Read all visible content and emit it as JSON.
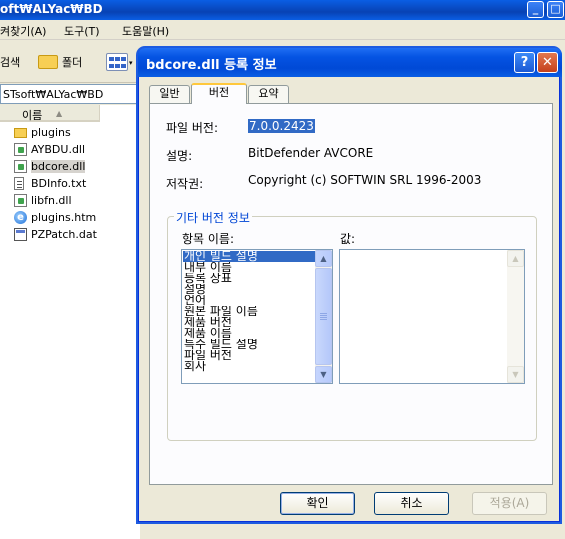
{
  "explorer": {
    "title": "oft₩ALYac₩BD",
    "menu": [
      "켜찾기(A)",
      "도구(T)",
      "도움말(H)"
    ],
    "toolbar": {
      "search_label": "검색",
      "folders_label": "폴더"
    },
    "address": "STsoft₩ALYac₩BD",
    "column_header": "이름",
    "sort_arrow": "▲",
    "files": [
      {
        "name": "plugins",
        "icon": "folder-icon"
      },
      {
        "name": "AYBDU.dll",
        "icon": "dll-icon"
      },
      {
        "name": "bdcore.dll",
        "icon": "dll-icon",
        "selected": true
      },
      {
        "name": "BDInfo.txt",
        "icon": "text-file-icon"
      },
      {
        "name": "libfn.dll",
        "icon": "dll-icon"
      },
      {
        "name": "plugins.htm",
        "icon": "ie-html-icon"
      },
      {
        "name": "PZPatch.dat",
        "icon": "dat-file-icon"
      }
    ],
    "window_controls": {
      "minimize": "_",
      "maximize": "□"
    }
  },
  "dialog": {
    "title": "bdcore.dll 등록 정보",
    "help_glyph": "?",
    "close_glyph": "✕",
    "tabs": [
      "일반",
      "버전",
      "요약"
    ],
    "active_tab": "버전",
    "fields": {
      "file_version_label": "파일 버전:",
      "file_version_value": "7.0.0.2423",
      "description_label": "설명:",
      "description_value": "BitDefender AVCORE",
      "copyright_label": "저작권:",
      "copyright_value": "Copyright (c) SOFTWIN SRL 1996-2003"
    },
    "other_info": {
      "legend": "기타 버전 정보",
      "item_name_label": "항목 이름:",
      "value_label": "값:",
      "items": [
        "개인 빌드 설명",
        "내부 이름",
        "등록 상표",
        "설명",
        "언어",
        "원본 파일 이름",
        "제품 버전",
        "제품 이름",
        "특수 빌드 설명",
        "파일 버전",
        "회사"
      ],
      "selected_item": "개인 빌드 설명"
    },
    "buttons": {
      "ok": "확인",
      "cancel": "취소",
      "apply": "적용(A)"
    },
    "colors": {
      "title_blue": "#0554e3",
      "selection_blue": "#316ac5",
      "legend_blue": "#0046d5"
    }
  }
}
